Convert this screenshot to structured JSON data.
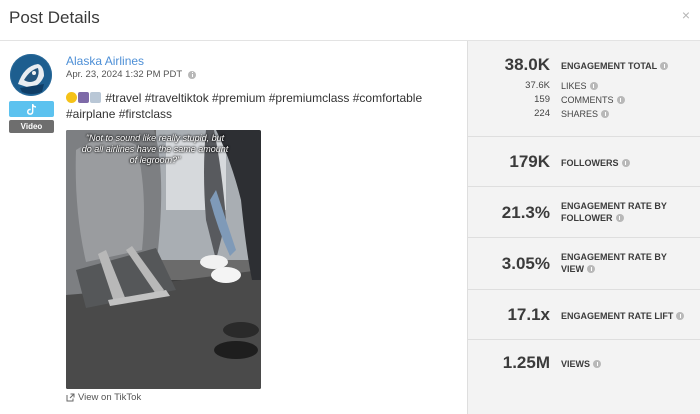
{
  "modal": {
    "title": "Post Details",
    "close_glyph": "×"
  },
  "post": {
    "author": "Alaska Airlines",
    "date": "Apr. 23, 2024 1:32 PM PDT",
    "caption_line1": "#travel #traveltiktok #premium #premiumclass #comfortable",
    "caption_line2": "#airplane #firstclass",
    "video_badge": "Video",
    "platform_icon": "tiktok-icon",
    "thumbnail_text": "\"Not to sound like really stupid, but do all airlines have the same amount of legroom?\"",
    "view_link": "View on TikTok"
  },
  "metrics": {
    "engagement_total": {
      "value": "38.0K",
      "label": "ENGAGEMENT TOTAL"
    },
    "likes": {
      "value": "37.6K",
      "label": "LIKES"
    },
    "comments": {
      "value": "159",
      "label": "COMMENTS"
    },
    "shares": {
      "value": "224",
      "label": "SHARES"
    },
    "followers": {
      "value": "179K",
      "label": "FOLLOWERS"
    },
    "rate_follower": {
      "value": "21.3%",
      "label1": "ENGAGEMENT RATE BY",
      "label2": "FOLLOWER"
    },
    "rate_view": {
      "value": "3.05%",
      "label1": "ENGAGEMENT RATE BY",
      "label2": "VIEW"
    },
    "rate_lift": {
      "value": "17.1x",
      "label": "ENGAGEMENT RATE LIFT"
    },
    "views": {
      "value": "1.25M",
      "label": "VIEWS"
    }
  },
  "colors": {
    "link": "#4d8fd6",
    "tiktok_badge": "#5cc2ef",
    "panel_bg": "#f3f3f3"
  }
}
